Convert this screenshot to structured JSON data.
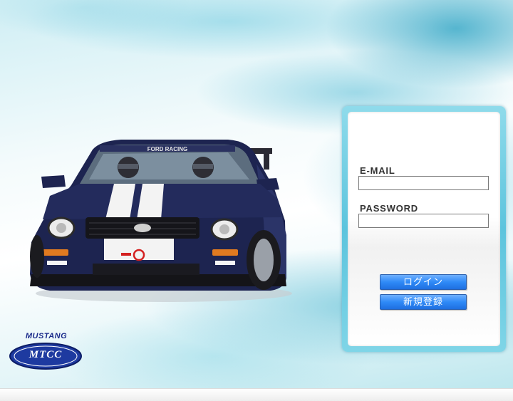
{
  "logo": {
    "brand": "MUSTANG",
    "club": "MTCC"
  },
  "login": {
    "email_label": "E-MAIL",
    "email_value": "",
    "password_label": "PASSWORD",
    "password_value": "",
    "login_button": "ログイン",
    "register_button": "新規登録"
  },
  "colors": {
    "accent": "#2f8af7",
    "panel_frame": "#5cc4dd",
    "logo_blue": "#1a2a8a"
  }
}
